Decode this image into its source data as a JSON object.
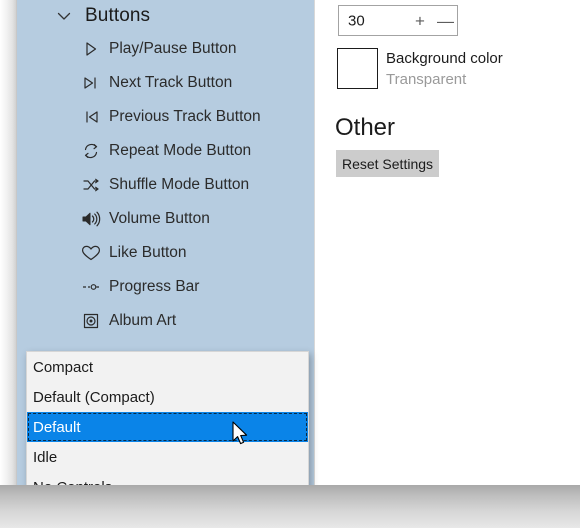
{
  "left_pane": {
    "group": {
      "chevron_icon": "chevron-down-icon",
      "title": "Buttons"
    },
    "items": [
      {
        "icon": "play-pause-icon",
        "label": "Play/Pause Button"
      },
      {
        "icon": "next-track-icon",
        "label": "Next Track Button"
      },
      {
        "icon": "previous-track-icon",
        "label": "Previous Track Button"
      },
      {
        "icon": "repeat-mode-icon",
        "label": "Repeat Mode Button"
      },
      {
        "icon": "shuffle-mode-icon",
        "label": "Shuffle Mode Button"
      },
      {
        "icon": "volume-icon",
        "label": "Volume Button"
      },
      {
        "icon": "heart-icon",
        "label": "Like Button"
      },
      {
        "icon": "progress-bar-icon",
        "label": "Progress Bar"
      },
      {
        "icon": "album-art-icon",
        "label": "Album Art"
      }
    ],
    "scrollbar": {
      "name": "vertical-scrollbar"
    }
  },
  "right_pane": {
    "spinner": {
      "value": "30",
      "increment_label": "+",
      "decrement_label": "—"
    },
    "background_color": {
      "label": "Background color",
      "value": "Transparent",
      "swatch_color": "#ffffff"
    },
    "other_section": {
      "heading": "Other",
      "reset_button_label": "Reset Settings"
    }
  },
  "dropdown": {
    "options": [
      {
        "label": "Compact",
        "selected": false
      },
      {
        "label": "Default (Compact)",
        "selected": false
      },
      {
        "label": "Default",
        "selected": true
      },
      {
        "label": "Idle",
        "selected": false
      },
      {
        "label": "No Controls",
        "selected": false
      }
    ],
    "highlight_color": "#0a84e8"
  },
  "colors": {
    "pane_background": "#b6cce0",
    "accent": "#0a84e8",
    "text": "#1b1b1b",
    "muted_text": "#9a9a9a",
    "button_face": "#cccccc"
  }
}
